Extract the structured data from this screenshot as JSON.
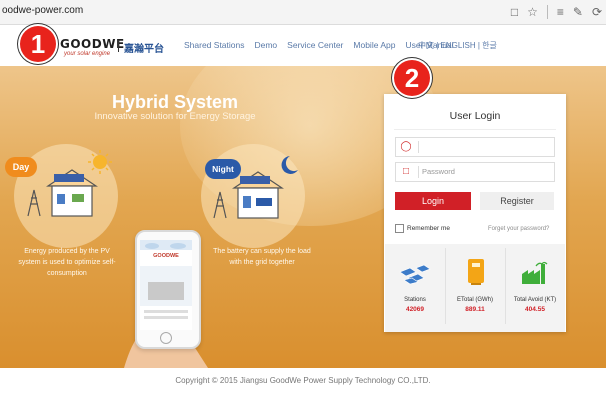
{
  "browser": {
    "url": "oodwe-power.com"
  },
  "nav": {
    "logo": "GOODWE",
    "tagline": "your solar engine",
    "brand_cn": "嘉瀚平台",
    "links": [
      "Shared Stations",
      "Demo",
      "Service Center",
      "Mobile App",
      "User Manual"
    ],
    "languages": "中文 | ENGLISH | 한글"
  },
  "hero": {
    "title": "Hybrid System",
    "subtitle": "Innovative solution for Energy Storage",
    "day_badge": "Day",
    "night_badge": "Night",
    "day_description": "Energy produced by the PV system is used to optimize self-consumption",
    "night_description": "The battery can supply the load with the grid together",
    "phone_brand": "GOODWE"
  },
  "login": {
    "title": "User Login",
    "username_value": "",
    "password_placeholder": "Password",
    "login_button": "Login",
    "register_button": "Register",
    "remember_me": "Remember me",
    "forgot_password": "Forget your password?"
  },
  "stats": [
    {
      "label": "Stations",
      "value": "42069",
      "icon": "solar-panel-icon"
    },
    {
      "label": "ETotal (GWh)",
      "value": "889.11",
      "icon": "inverter-icon"
    },
    {
      "label": "Total Avoid (KT)",
      "value": "404.55",
      "icon": "factory-icon"
    }
  ],
  "footer": {
    "copyright": "Copyright © 2015 Jiangsu GoodWe Power Supply Technology CO.,LTD."
  },
  "markers": [
    "1",
    "2"
  ],
  "colors": {
    "accent_red": "#d12027",
    "hero_orange": "#e2a650",
    "link_blue": "#5a7aa8"
  }
}
